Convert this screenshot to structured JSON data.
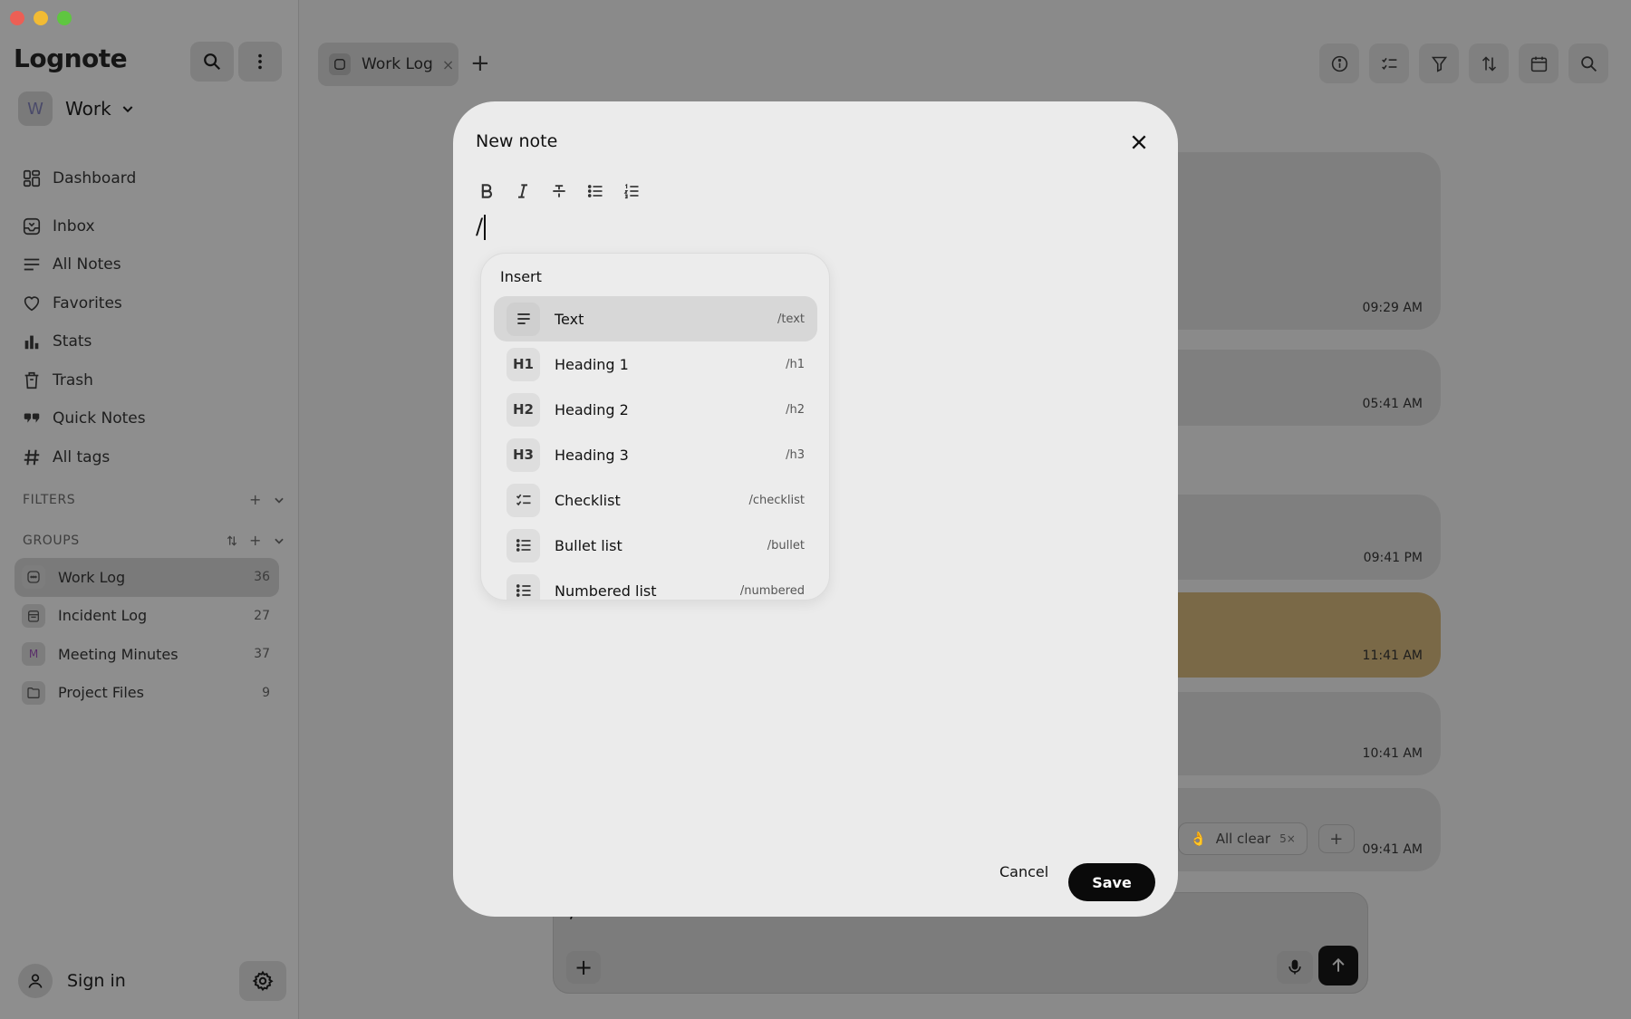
{
  "app": {
    "title": "Lognote"
  },
  "workspace": {
    "avatar": "W",
    "name": "Work"
  },
  "nav": [
    {
      "label": "Dashboard",
      "icon": "dashboard-icon"
    },
    {
      "label": "Inbox",
      "icon": "inbox-icon"
    },
    {
      "label": "All Notes",
      "icon": "notes-icon"
    },
    {
      "label": "Favorites",
      "icon": "heart-icon"
    },
    {
      "label": "Stats",
      "icon": "bar-chart-icon"
    },
    {
      "label": "Trash",
      "icon": "trash-icon"
    },
    {
      "label": "Quick Notes",
      "icon": "quote-icon"
    },
    {
      "label": "All tags",
      "icon": "hash-icon"
    }
  ],
  "sections": {
    "filters": "FILTERS",
    "groups": "GROUPS"
  },
  "groups": [
    {
      "label": "Work Log",
      "count": "36",
      "active": true,
      "icon": "chat-box-icon"
    },
    {
      "label": "Incident Log",
      "count": "27",
      "icon": "calendar-icon"
    },
    {
      "label": "Meeting Minutes",
      "count": "37",
      "icon": "letter-m-icon",
      "icon_text": "M"
    },
    {
      "label": "Project Files",
      "count": "9",
      "icon": "folder-icon"
    }
  ],
  "signin": {
    "label": "Sign in"
  },
  "tabs": [
    {
      "label": "Work Log",
      "close": "×"
    }
  ],
  "new_tab": "+",
  "notes": [
    {
      "time": "09:29 AM"
    },
    {
      "time": "05:41 AM"
    },
    {
      "time": "09:41 PM"
    },
    {
      "time": "11:41 AM",
      "color": "#7a6947"
    },
    {
      "time": "10:41 AM"
    },
    {
      "time": "09:41 AM"
    }
  ],
  "reaction_chip": {
    "emoji": "👌",
    "label": "All clear",
    "count": "5×",
    "add": "+"
  },
  "composer": {
    "text": "/",
    "plus": "+"
  },
  "modal": {
    "title": "New note",
    "editor_text": "/",
    "format_buttons": [
      "bold-icon",
      "italic-icon",
      "strikethrough-icon",
      "bullet-list-icon",
      "numbered-list-icon"
    ],
    "insert": {
      "title": "Insert",
      "items": [
        {
          "label": "Text",
          "shortcut": "/text",
          "icon": "text-icon",
          "highlighted": true
        },
        {
          "label": "Heading 1",
          "shortcut": "/h1",
          "icon_text": "H1"
        },
        {
          "label": "Heading 2",
          "shortcut": "/h2",
          "icon_text": "H2"
        },
        {
          "label": "Heading 3",
          "shortcut": "/h3",
          "icon_text": "H3"
        },
        {
          "label": "Checklist",
          "shortcut": "/checklist",
          "icon": "checklist-icon"
        },
        {
          "label": "Bullet list",
          "shortcut": "/bullet",
          "icon": "bullet-list-icon"
        },
        {
          "label": "Numbered list",
          "shortcut": "/numbered",
          "icon": "numbered-list-icon"
        }
      ]
    },
    "cancel": "Cancel",
    "save": "Save"
  },
  "colors": {
    "accent": "#0a0a0a",
    "modal_bg": "#ebebeb",
    "overlay": "#8a8a8a",
    "note_yellow": "#7a6947"
  }
}
